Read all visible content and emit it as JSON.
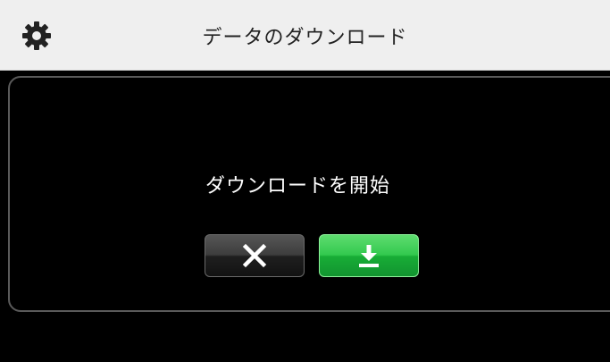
{
  "header": {
    "title": "データのダウンロード",
    "settings_icon": "gear-icon"
  },
  "dialog": {
    "message": "ダウンロードを開始",
    "cancel_icon": "close-icon",
    "confirm_icon": "download-icon"
  },
  "colors": {
    "header_bg": "#efefef",
    "dialog_bg": "#000000",
    "confirm_green": "#2fbf4a",
    "cancel_dark": "#2a2a2a"
  }
}
